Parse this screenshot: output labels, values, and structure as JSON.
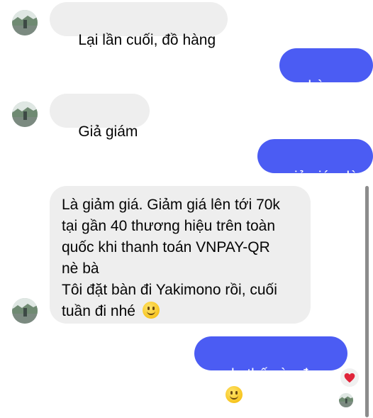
{
  "messages": [
    {
      "side": "incoming",
      "text": "Lại lần cuối, đồ hàng"
    },
    {
      "side": "outgoing",
      "text": "hàng giả"
    },
    {
      "side": "incoming",
      "text": "Giả giám"
    },
    {
      "side": "outgoing",
      "text": "giả giám là j"
    },
    {
      "side": "incoming",
      "lines": [
        "Là giảm giá. Giảm giá lên tới 70k",
        "tại gần 40 thương hiệu trên toàn",
        "quốc khi thanh toán VNPAY-QR",
        "nè bà",
        "Tôi đặt bàn đi Yakimono rồi, cuối",
        "tuần đi nhé"
      ],
      "emoji": "slightly-smiling-face"
    },
    {
      "side": "outgoing",
      "text": "ok, thế còn được",
      "emoji": "slightly-smiling-face",
      "reaction": "red-heart"
    }
  ],
  "colors": {
    "outgoing_bubble": "#4b5cf3",
    "incoming_bubble": "#eeeeee",
    "reaction_heart": "#e0243a"
  },
  "icons": [
    "avatar",
    "slightly-smiling-face-icon",
    "heart-reaction-icon",
    "seen-avatar-icon"
  ]
}
